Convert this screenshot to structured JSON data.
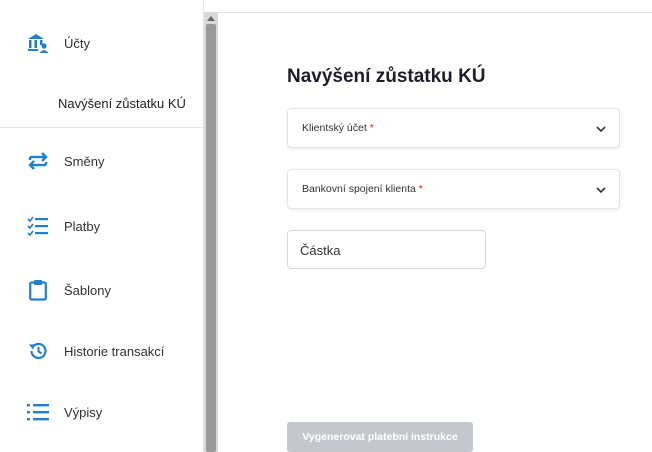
{
  "colors": {
    "accent": "#1f7fd1",
    "required": "#d0231e",
    "button_disabled": "#c4c7cd"
  },
  "sidebar": {
    "items": [
      {
        "label": "Účty",
        "icon": "bank-user-icon"
      },
      {
        "label": "Směny",
        "icon": "exchange-arrows-icon"
      },
      {
        "label": "Platby",
        "icon": "checklist-icon"
      },
      {
        "label": "Šablony",
        "icon": "clipboard-icon"
      },
      {
        "label": "Historie transakcí",
        "icon": "history-icon"
      },
      {
        "label": "Výpisy",
        "icon": "list-icon"
      }
    ],
    "sub_item": "Navýšení zůstatku KÚ"
  },
  "main": {
    "title": "Navýšení zůstatku KÚ",
    "client_account": {
      "label": "Klientský účet",
      "required_mark": "*"
    },
    "bank_connection": {
      "label": "Bankovní spojení klienta",
      "required_mark": "*"
    },
    "amount": {
      "placeholder": "Částka"
    },
    "generate_button": "Vygenerovat platební instrukce"
  }
}
